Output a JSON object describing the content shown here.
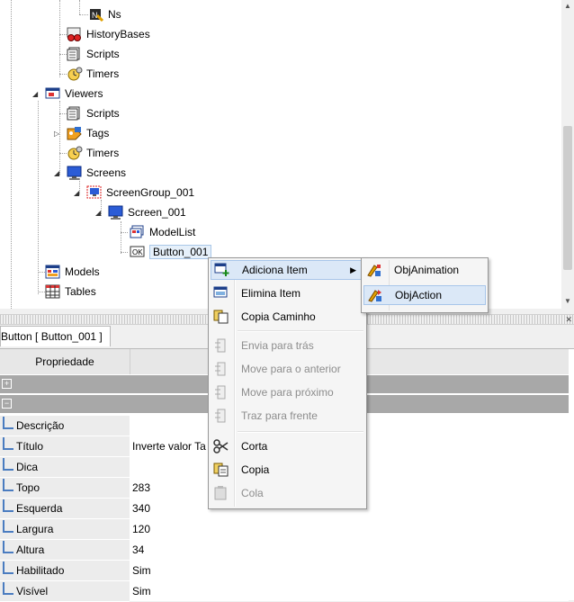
{
  "tree": {
    "nodes": [
      {
        "label": "Ns",
        "icon": "ns-icon"
      },
      {
        "label": "HistoryBases",
        "icon": "history-icon"
      },
      {
        "label": "Scripts",
        "icon": "scripts-icon"
      },
      {
        "label": "Timers",
        "icon": "timers-icon"
      },
      {
        "label": "Viewers",
        "icon": "viewers-icon"
      },
      {
        "label": "Scripts",
        "icon": "scripts-icon"
      },
      {
        "label": "Tags",
        "icon": "tags-icon"
      },
      {
        "label": "Timers",
        "icon": "timers-icon"
      },
      {
        "label": "Screens",
        "icon": "screens-icon"
      },
      {
        "label": "ScreenGroup_001",
        "icon": "screen-group-icon"
      },
      {
        "label": "Screen_001",
        "icon": "screen-icon"
      },
      {
        "label": "ModelList",
        "icon": "model-list-icon"
      },
      {
        "label": "Button_001",
        "icon": "ok-button-icon"
      },
      {
        "label": "Models",
        "icon": "models-icon"
      },
      {
        "label": "Tables",
        "icon": "tables-icon"
      }
    ]
  },
  "tab": {
    "label": "Button [ Button_001 ]"
  },
  "properties": {
    "header": "Propriedade",
    "rows": [
      {
        "name": "Descrição",
        "value": ""
      },
      {
        "name": "Título",
        "value": "Inverte valor Ta"
      },
      {
        "name": "Dica",
        "value": ""
      },
      {
        "name": "Topo",
        "value": "283"
      },
      {
        "name": "Esquerda",
        "value": "340"
      },
      {
        "name": "Largura",
        "value": "120"
      },
      {
        "name": "Altura",
        "value": "34"
      },
      {
        "name": "Habilitado",
        "value": "Sim"
      },
      {
        "name": "Visível",
        "value": "Sim"
      }
    ]
  },
  "context_menu": {
    "items": [
      {
        "label": "Adiciona Item",
        "icon": "add-item-icon",
        "enabled": true,
        "submenu": true
      },
      {
        "label": "Elimina Item",
        "icon": "delete-item-icon",
        "enabled": true
      },
      {
        "label": "Copia Caminho",
        "icon": "copy-path-icon",
        "enabled": true
      },
      {
        "label": "Envia para trás",
        "icon": "send-back-icon",
        "enabled": false
      },
      {
        "label": "Move para o anterior",
        "icon": "move-previous-icon",
        "enabled": false
      },
      {
        "label": "Move para próximo",
        "icon": "move-next-icon",
        "enabled": false
      },
      {
        "label": "Traz para frente",
        "icon": "bring-front-icon",
        "enabled": false
      },
      {
        "label": "Corta",
        "icon": "cut-icon",
        "enabled": true
      },
      {
        "label": "Copia",
        "icon": "copy-icon",
        "enabled": true
      },
      {
        "label": "Cola",
        "icon": "paste-icon",
        "enabled": false
      }
    ]
  },
  "submenu": {
    "items": [
      {
        "label": "ObjAnimation",
        "icon": "obj-animation-icon"
      },
      {
        "label": "ObjAction",
        "icon": "obj-action-icon"
      }
    ]
  },
  "colors": {
    "highlight": "#dbe8f7",
    "group_bar": "#a8a8a8",
    "tree_line": "#a0a0a0"
  }
}
